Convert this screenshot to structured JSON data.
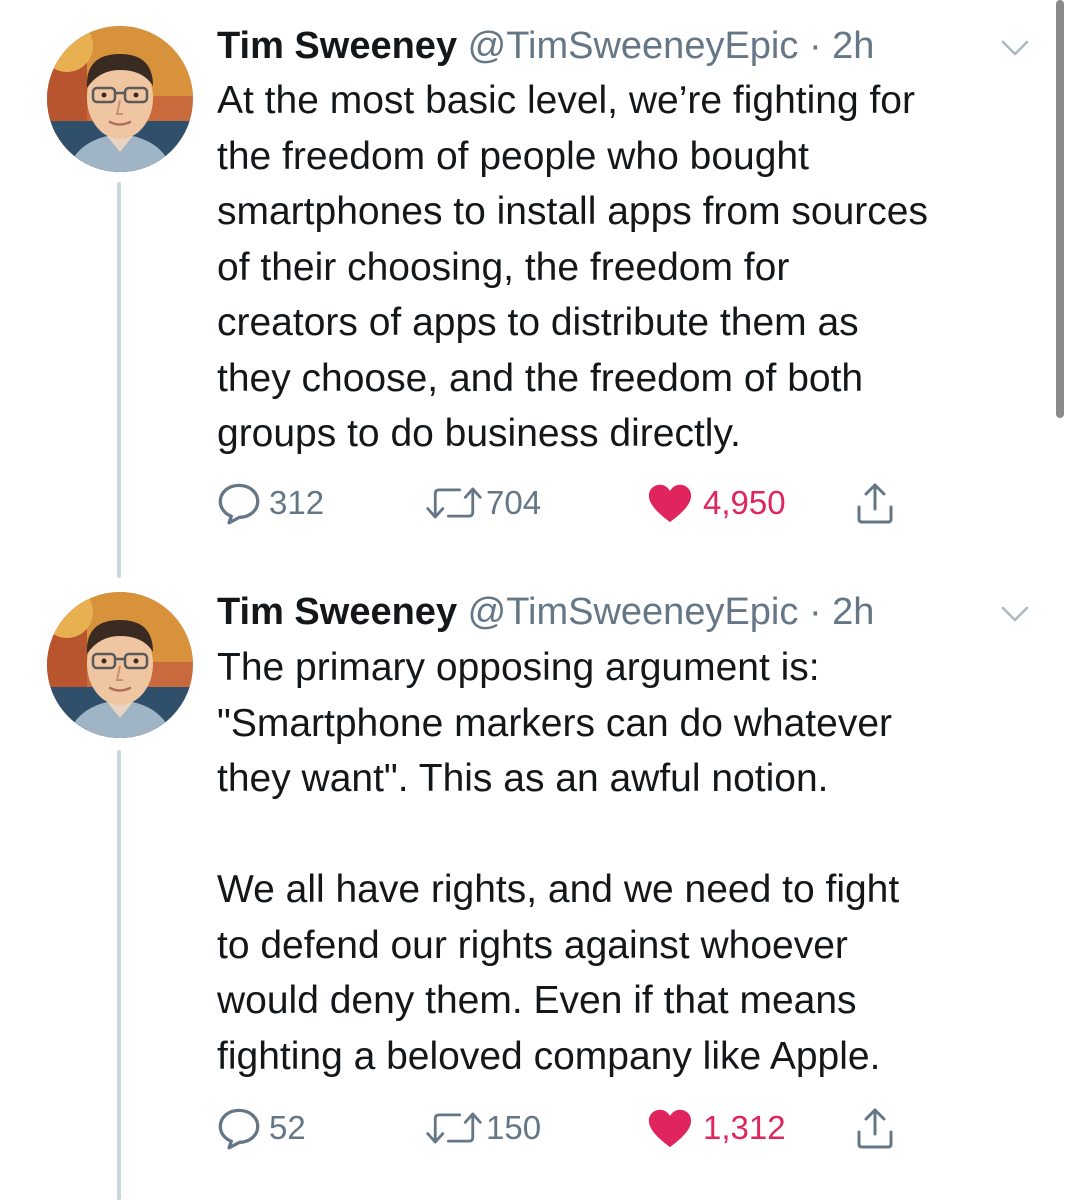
{
  "tweets": [
    {
      "author": {
        "name": "Tim Sweeney",
        "handle": "@TimSweeneyEpic",
        "separator": "·",
        "time": "2h"
      },
      "text": "At the most basic level, we’re fighting for\nthe freedom of people who bought\nsmartphones to install apps from sources\nof their choosing, the freedom for\ncreators of apps to distribute them as\nthey choose, and the freedom of both\ngroups to do business directly.",
      "stats": {
        "replies": "312",
        "retweets": "704",
        "likes": "4,950",
        "liked": true
      }
    },
    {
      "author": {
        "name": "Tim Sweeney",
        "handle": "@TimSweeneyEpic",
        "separator": "·",
        "time": "2h"
      },
      "text": "The primary opposing argument is:\n\"Smartphone markers can do whatever\nthey want\". This as an awful notion.\n\nWe all have rights, and we need to fight\nto defend our rights against whoever\nwould deny them. Even if that means\nfighting a beloved company like Apple.",
      "stats": {
        "replies": "52",
        "retweets": "150",
        "likes": "1,312",
        "liked": true
      }
    }
  ],
  "colors": {
    "text": "#14171a",
    "muted": "#657786",
    "like": "#e0245e",
    "thread_line": "#ccd6dd"
  },
  "icons": [
    "reply-icon",
    "retweet-icon",
    "heart-icon",
    "share-icon",
    "chevron-down-icon"
  ]
}
